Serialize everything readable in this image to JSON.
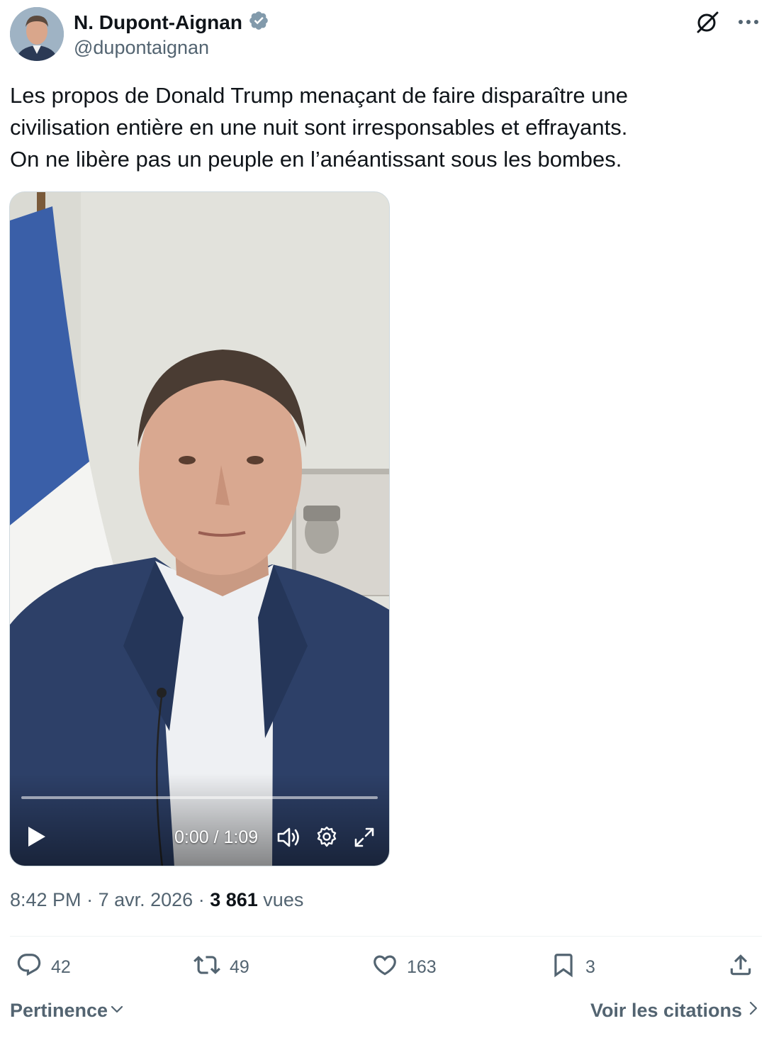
{
  "author": {
    "name": "N. Dupont-Aignan",
    "handle": "@dupontaignan",
    "verified": true,
    "verified_color": "#829aab"
  },
  "tweet": {
    "lines": [
      "Les propos de Donald Trump menaçant de faire disparaître une",
      "civilisation entière en une nuit sont irresponsables et effrayants.",
      "On ne libère pas un peuple en l’anéantissant sous les bombes."
    ]
  },
  "video": {
    "time": "0:00 / 1:09",
    "progress": 0.0
  },
  "meta": {
    "time": "8:42 PM",
    "date": "7 avr. 2026",
    "views_count": "3 861",
    "views_label": "vues"
  },
  "actions": {
    "replies": "42",
    "reposts": "49",
    "likes": "163",
    "bookmarks": "3"
  },
  "footer": {
    "sort_label": "Pertinence",
    "quotes_label": "Voir les citations"
  },
  "colors": {
    "text": "#0f1419",
    "secondary": "#536471",
    "divider": "#eff3f4"
  },
  "icons": [
    "grok-icon",
    "more-icon",
    "verified-badge-icon",
    "play-icon",
    "volume-icon",
    "settings-icon",
    "fullscreen-icon",
    "reply-icon",
    "repost-icon",
    "like-icon",
    "bookmark-icon",
    "share-icon",
    "chevron-down-icon",
    "chevron-right-icon"
  ]
}
